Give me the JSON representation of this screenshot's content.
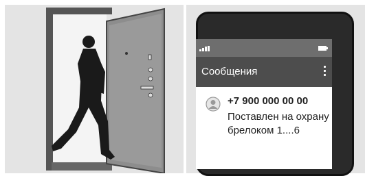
{
  "messages_app": {
    "title": "Сообщения",
    "message": {
      "sender": "+7 900 000 00 00",
      "text": "Поставлен на охрану брелоком 1....6"
    }
  },
  "icons": {
    "signal": "signal-strength-icon",
    "battery": "battery-icon",
    "overflow_menu": "more-vert-icon",
    "avatar": "person-avatar-icon"
  },
  "colors": {
    "appbar": "#4d4d4d",
    "statusbar": "#6e6e6e",
    "phone_body": "#2a2a2a"
  }
}
